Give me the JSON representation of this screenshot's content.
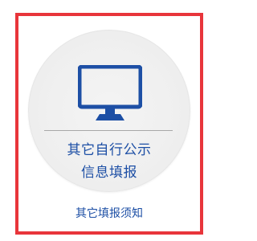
{
  "card": {
    "border_color": "#e8353b",
    "icon": "monitor-icon",
    "icon_color": "#1d4fa5",
    "title_line1": "其它自行公示",
    "title_line2": "信息填报",
    "notice_link": "其它填报须知"
  }
}
